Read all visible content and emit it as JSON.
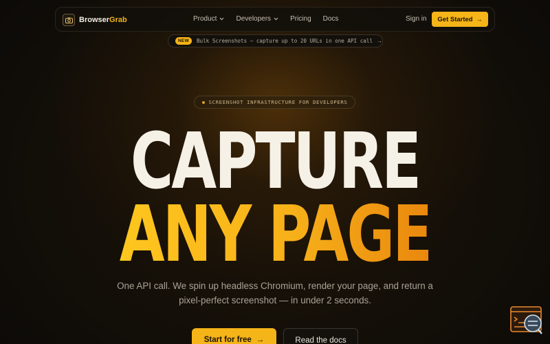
{
  "brand": {
    "name_main": "Browser",
    "name_accent": "Grab",
    "icon": "camera-icon"
  },
  "nav": {
    "links": [
      {
        "label": "Product",
        "dropdown": true
      },
      {
        "label": "Developers",
        "dropdown": true
      },
      {
        "label": "Pricing",
        "dropdown": false
      },
      {
        "label": "Docs",
        "dropdown": false
      }
    ],
    "signin": "Sign in",
    "cta": "Get Started",
    "cta_arrow": "→"
  },
  "announcement": {
    "badge": "NEW",
    "text": "Bulk Screenshots — capture up to 20 URLs in one API call",
    "arrow": "→"
  },
  "hero": {
    "eyebrow": "SCREENSHOT INFRASTRUCTURE FOR DEVELOPERS",
    "headline_line1": "CAPTURE",
    "headline_line2": "ANY PAGE",
    "subtitle": "One API call. We spin up headless Chromium, render your page, and return a pixel-perfect screenshot — in under 2 seconds.",
    "primary_button": "Start for free",
    "primary_arrow": "→",
    "secondary_button": "Read the docs"
  },
  "colors": {
    "accent": "#f5b417",
    "background": "#0d0b08",
    "headline": "#f6f1e7",
    "headline_gradient_end": "#e9870e"
  },
  "widget": {
    "icon": "chat-support-icon"
  }
}
